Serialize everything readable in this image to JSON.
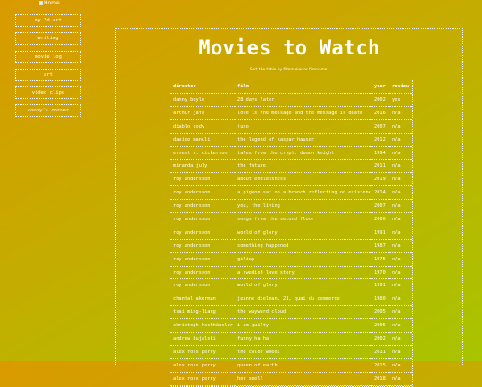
{
  "home": {
    "label": "Home"
  },
  "nav": {
    "items": [
      "my 3d art",
      "writing",
      "movie log",
      "art",
      "video clips",
      "coopy's corner"
    ]
  },
  "page": {
    "title": "Movies to Watch",
    "subtitle": "Sort the table by filmmaker or filmname!"
  },
  "table": {
    "headers": [
      "director",
      "film",
      "year",
      "review"
    ],
    "rows": [
      [
        "danny boyle",
        "28 days later",
        "2002",
        "yes"
      ],
      [
        "arthur jafa",
        "love is the message and the message is death",
        "2016",
        "n/a"
      ],
      [
        "diablo cody",
        "juno",
        "2007",
        "n/a"
      ],
      [
        "davide manuli",
        "the legend of kaspar hauser",
        "2012",
        "n/a"
      ],
      [
        "ernest r. dickerson",
        "tales from the crypt: demon knight",
        "1994",
        "n/a"
      ],
      [
        "miranda july",
        "the future",
        "2011",
        "n/a"
      ],
      [
        "roy andersson",
        "about endlessness",
        "2019",
        "n/a"
      ],
      [
        "roy andersson",
        "a pigeon sat on a branch reflecting on existence",
        "2014",
        "n/a"
      ],
      [
        "roy andersson",
        "you, the living",
        "2007",
        "n/a"
      ],
      [
        "roy andersson",
        "songs from the second floor",
        "2000",
        "n/a"
      ],
      [
        "roy andersson",
        "world of glory",
        "1991",
        "n/a"
      ],
      [
        "roy andersson",
        "something happened",
        "1987",
        "n/a"
      ],
      [
        "roy andersson",
        "giliap",
        "1975",
        "n/a"
      ],
      [
        "roy andersson",
        "a swedish love story",
        "1970",
        "n/a"
      ],
      [
        "roy andersson",
        "world of glory",
        "1991",
        "n/a"
      ],
      [
        "chantal akerman",
        "jeanne dielman, 23, quai du commerce",
        "1980",
        "n/a"
      ],
      [
        "tsai ming-liang",
        "the wayward cloud",
        "2005",
        "n/a"
      ],
      [
        "christoph hochhäusler",
        "i am guilty",
        "2005",
        "n/a"
      ],
      [
        "andrew bujalski",
        "funny ha ha",
        "2002",
        "n/a"
      ],
      [
        "alex ross perry",
        "the color wheel",
        "2011",
        "n/a"
      ],
      [
        "alex ross perry",
        "queen of earth",
        "2015",
        "n/a"
      ],
      [
        "alex ross perry",
        "her smell",
        "2018",
        "n/a"
      ]
    ]
  }
}
